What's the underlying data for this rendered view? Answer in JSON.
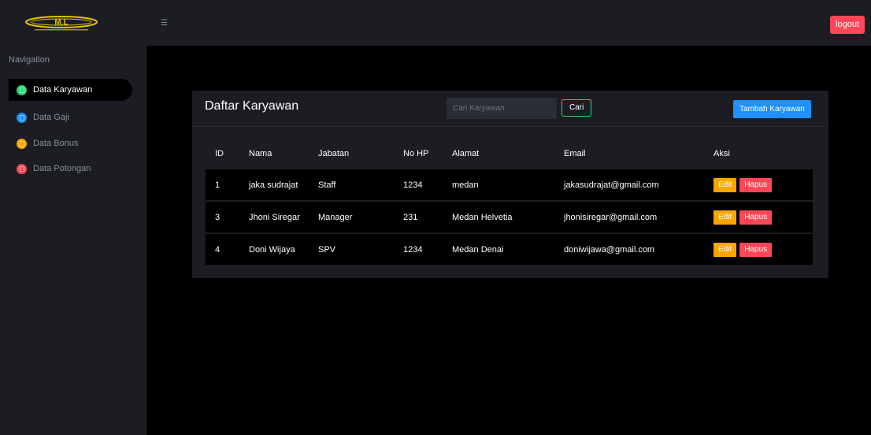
{
  "header": {
    "logo_text": "M.L",
    "logout_label": "logout"
  },
  "sidebar": {
    "heading": "Navigation",
    "items": [
      {
        "label": "Data Karyawan",
        "icon": "id-card-icon",
        "color": "#2ed573",
        "active": true
      },
      {
        "label": "Data Gaji",
        "icon": "wallet-icon",
        "color": "#1e90ff",
        "active": false
      },
      {
        "label": "Data Bonus",
        "icon": "gift-icon",
        "color": "#ffa502",
        "active": false
      },
      {
        "label": "Data Potongan",
        "icon": "cut-icon",
        "color": "#ff4757",
        "active": false
      }
    ]
  },
  "card": {
    "title": "Daftar Karyawan",
    "search_placeholder": "Cari Karyawan",
    "search_button": "Cari",
    "add_button": "Tambah Karyawan"
  },
  "table": {
    "columns": [
      "ID",
      "Nama",
      "Jabatan",
      "No HP",
      "Alamat",
      "Email",
      "Aksi"
    ],
    "rows": [
      {
        "id": "1",
        "nama": "jaka sudrajat",
        "jabatan": "Staff",
        "nohp": "1234",
        "alamat": "medan",
        "email": "jakasudrajat@gmail.com"
      },
      {
        "id": "3",
        "nama": "Jhoni Siregar",
        "jabatan": "Manager",
        "nohp": "231",
        "alamat": "Medan Helvetia",
        "email": "jhonisiregar@gmail.com"
      },
      {
        "id": "4",
        "nama": "Doni Wijaya",
        "jabatan": "SPV",
        "nohp": "1234",
        "alamat": "Medan Denai",
        "email": "doniwijawa@gmail.com"
      }
    ],
    "edit_label": "Edit",
    "delete_label": "Hapus"
  },
  "colors": {
    "background": "#000000",
    "panel": "#1b1d23",
    "primary": "#1e90ff",
    "success": "#2ed573",
    "warning": "#ffa502",
    "danger": "#ff4757",
    "logo": "#e6c200"
  }
}
